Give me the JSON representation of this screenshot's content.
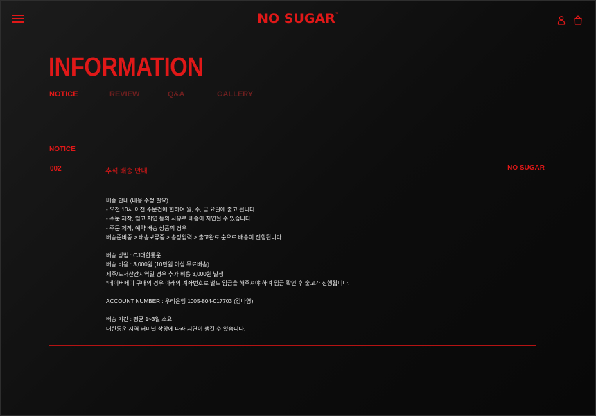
{
  "header": {
    "logo_text": "NO SUGAR",
    "logo_mark": "™",
    "icons": [
      "menu-icon",
      "user-icon",
      "cart-icon"
    ],
    "accent_color": "#e01818"
  },
  "page": {
    "title": "INFORMATION",
    "tabs": [
      {
        "label": "NOTICE",
        "active": true
      },
      {
        "label": "REVIEW",
        "active": false
      },
      {
        "label": "Q&A",
        "active": false
      },
      {
        "label": "GALLERY",
        "active": false
      }
    ]
  },
  "board": {
    "section_label": "NOTICE",
    "post": {
      "number": "002",
      "subject": "추석 배송 안내",
      "author": "NO SUGAR"
    },
    "body": [
      "배송 안내 (내용 수정 필요)",
      "- 오전 10시 이전 주문건에 한하여 월, 수, 금 요일에 출고 됩니다.",
      "- 주문 제작, 입고 지연 등의 사유로 배송이 지연될 수 있습니다.",
      "- 주문 제작, 예약 배송 상품의 경우",
      "배송준비중 > 배송보류중 > 송장입력 > 출고완료 순으로 배송이 진행됩니다",
      "",
      "배송 방법 : CJ대한통운",
      "배송 비용 : 3,000원 (10만원 이상 무료배송)",
      "제주/도서산간지역일 경우 추가 비용 3,000원 발생",
      "*네이버페이 구매의 경우 아래의 계좌번호로 별도 입금을 해주셔야 하며 입금 확인 후 출고가 진행됩니다.",
      "",
      "ACCOUNT NUMBER : 우리은행 1005-804-017703 (김나영)",
      "",
      "배송 기간 : 평균 1~3일 소요",
      "대한통운 지역 터미널 상황에 따라 지연이 생길 수 있습니다."
    ]
  }
}
